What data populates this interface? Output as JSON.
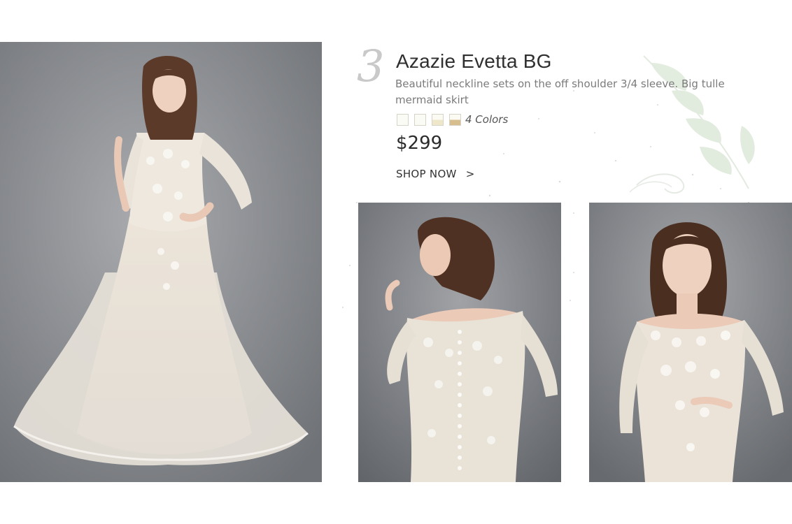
{
  "product": {
    "index": "3",
    "title": "Azazie Evetta BG",
    "description": "Beautiful neckline sets on the off shoulder 3/4 sleeve. Big tulle mermaid skirt",
    "colors_label": "4 Colors",
    "price": "$299",
    "cta_label": "SHOP NOW",
    "cta_arrow": ">"
  },
  "swatches": [
    {
      "name": "white",
      "color": "#fbfbf6"
    },
    {
      "name": "diamond-white",
      "color": "#faf8ef"
    },
    {
      "name": "ivory",
      "color": "#efe7c9"
    },
    {
      "name": "champagne",
      "color": "#d7be8e"
    }
  ],
  "photos": [
    {
      "name": "dress-full-length-photo"
    },
    {
      "name": "dress-back-view-photo"
    },
    {
      "name": "dress-front-bodice-photo"
    }
  ],
  "theme": {
    "photo_background": "#8e9094",
    "dress_color": "#ece4d8",
    "lace_color": "#f7f4ef",
    "leaf_color": "#cfe0c8",
    "index_color": "#c9c9c9"
  }
}
